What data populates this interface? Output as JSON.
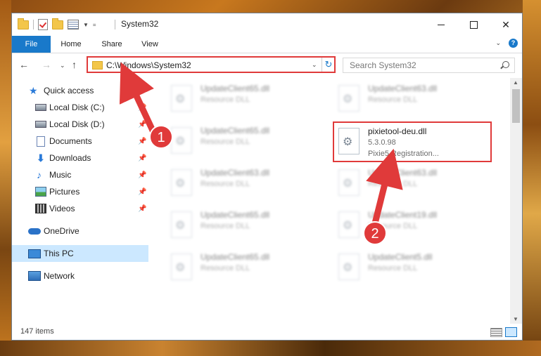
{
  "window": {
    "title": "System32",
    "controls": {
      "minimize": "minimize",
      "maximize": "maximize",
      "close": "✕"
    }
  },
  "ribbon": {
    "tabs": [
      {
        "label": "File"
      },
      {
        "label": "Home"
      },
      {
        "label": "Share"
      },
      {
        "label": "View"
      }
    ],
    "help": "?"
  },
  "nav": {
    "address": "C:\\Windows\\System32",
    "search_placeholder": "Search System32"
  },
  "sidebar": {
    "items": [
      {
        "label": "Quick access",
        "icon": "star-icon",
        "pinned": false
      },
      {
        "label": "Local Disk (C:)",
        "icon": "disk-icon",
        "pinned": true
      },
      {
        "label": "Local Disk (D:)",
        "icon": "disk-icon",
        "pinned": true
      },
      {
        "label": "Documents",
        "icon": "document-icon",
        "pinned": true
      },
      {
        "label": "Downloads",
        "icon": "download-icon",
        "pinned": true
      },
      {
        "label": "Music",
        "icon": "music-icon",
        "pinned": true
      },
      {
        "label": "Pictures",
        "icon": "pictures-icon",
        "pinned": true
      },
      {
        "label": "Videos",
        "icon": "videos-icon",
        "pinned": true
      },
      {
        "label": "OneDrive",
        "icon": "onedrive-icon",
        "pinned": false
      },
      {
        "label": "This PC",
        "icon": "computer-icon",
        "pinned": false,
        "selected": true
      },
      {
        "label": "Network",
        "icon": "network-icon",
        "pinned": false
      }
    ]
  },
  "files": {
    "left": [
      {
        "name": "UpdateClient65.dll",
        "type": "Resource DLL"
      },
      {
        "name": "UpdateClient65.dll",
        "type": "Resource DLL"
      },
      {
        "name": "UpdateClient63.dll",
        "type": "Resource DLL"
      },
      {
        "name": "UpdateClient65.dll",
        "type": "Resource DLL"
      },
      {
        "name": "UpdateClient65.dll",
        "type": "Resource DLL"
      }
    ],
    "right": [
      {
        "name": "UpdateClient63.dll",
        "type": "Resource DLL"
      },
      {
        "name": "pixietool-deu.dll",
        "version": "5.3.0.98",
        "type": "Pixie5 Registration...",
        "highlighted": true
      },
      {
        "name": "UpdateClient63.dll",
        "type": "Resource DLL"
      },
      {
        "name": "UpdateClient19.dll",
        "type": "Resource DLL"
      },
      {
        "name": "UpdateClient5.dll",
        "type": "Resource DLL"
      }
    ]
  },
  "status": {
    "item_count": "147 items"
  },
  "annotations": {
    "marker1": "1",
    "marker2": "2",
    "color": "#e03a3a"
  }
}
